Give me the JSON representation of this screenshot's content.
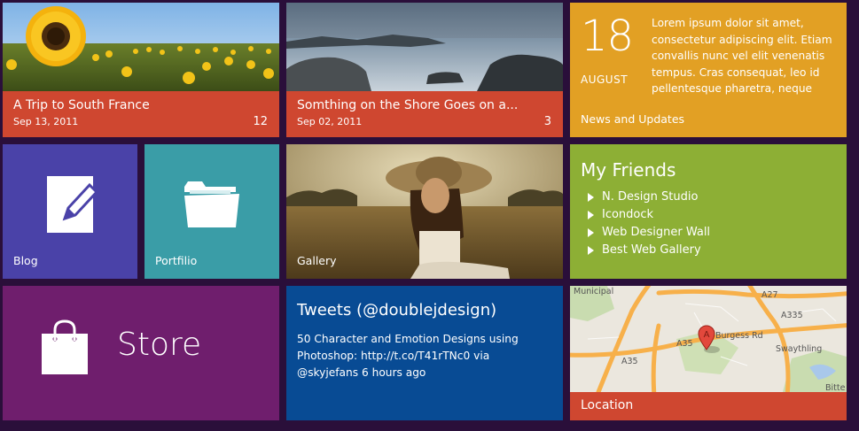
{
  "tiles": {
    "sunflower": {
      "title": "A Trip to South France",
      "date": "Sep 13, 2011",
      "count": "12"
    },
    "shore": {
      "title": "Somthing on the Shore Goes on a...",
      "date": "Sep 02, 2011",
      "count": "3"
    },
    "news": {
      "day": "18",
      "month": "AUGUST",
      "text": "Lorem ipsum dolor sit amet, consectetur adipiscing elit. Etiam convallis nunc vel elit venenatis tempus. Cras consequat, leo id pellentesque pharetra, neque",
      "label": "News and Updates"
    },
    "blog": {
      "label": "Blog"
    },
    "portfolio": {
      "label": "Portfilio"
    },
    "gallery": {
      "label": "Gallery"
    },
    "friends": {
      "title": "My Friends",
      "items": [
        "N. Design Studio",
        "Icondock",
        "Web Designer Wall",
        "Best Web Gallery"
      ]
    },
    "store": {
      "label": "Store"
    },
    "tweets": {
      "title": "Tweets (@doublejdesign)",
      "body": "50 Character and Emotion Designs using Photoshop: http://t.co/T41rTNc0 via @skyjefans 6 hours ago"
    },
    "location": {
      "label": "Location",
      "map_labels": {
        "municipal": "Municipal",
        "a27": "A27",
        "a335": "A335",
        "a35_upper": "A35",
        "a35_lower": "A35",
        "burgess": "Burgess Rd",
        "swaythling": "Swaythling",
        "bitterne": "Bitte",
        "a_pin": "A"
      }
    }
  },
  "colors": {
    "background": "#2a0f3a",
    "red": "#cf4730",
    "orange": "#e2a024",
    "indigo": "#4a42a8",
    "teal": "#3a9da7",
    "green": "#8daf35",
    "purple": "#6f1e6d",
    "blue": "#084b94"
  },
  "icons": {
    "blog": "pencil-note-icon",
    "portfolio": "folder-icon",
    "store": "shopping-bag-icon",
    "friends_bullet": "triangle-right-icon",
    "map_marker": "map-pin-icon"
  }
}
